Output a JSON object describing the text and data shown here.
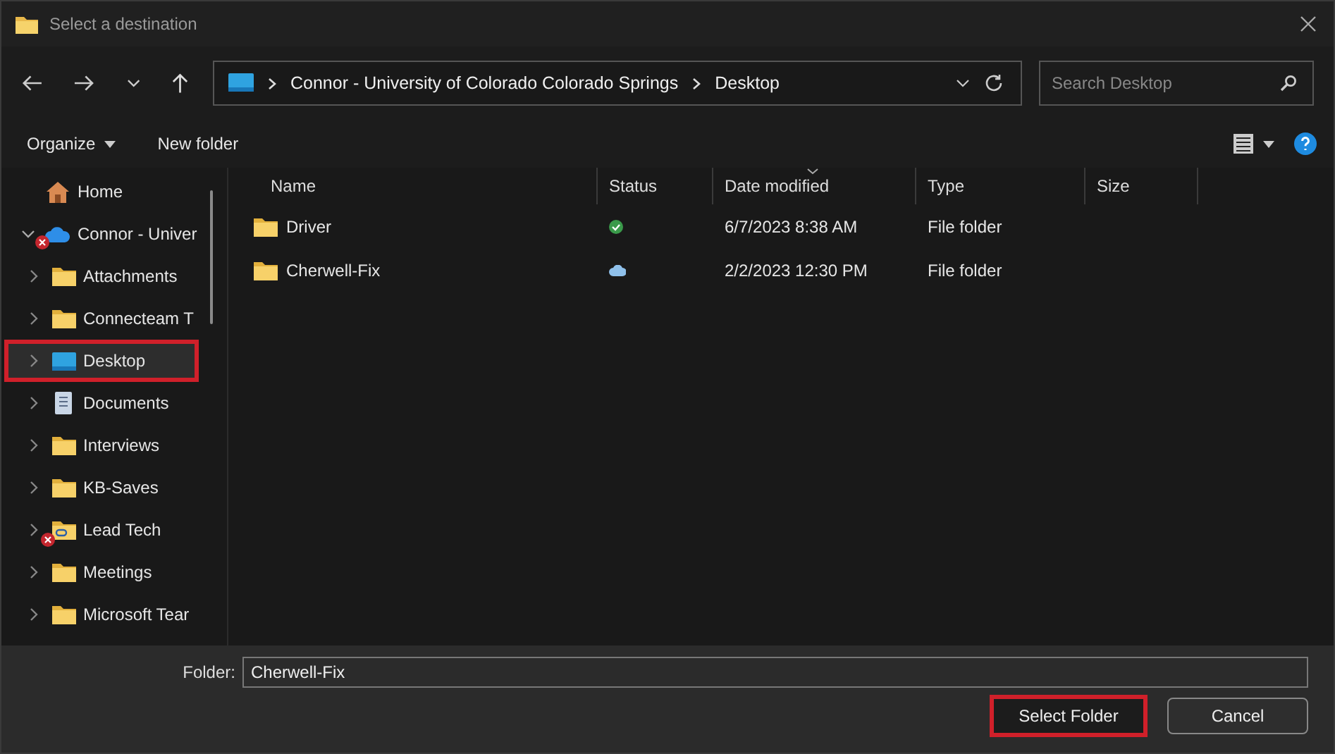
{
  "window": {
    "title": "Select a destination"
  },
  "address": {
    "segments": [
      "Connor - University of Colorado Colorado Springs",
      "Desktop"
    ]
  },
  "search": {
    "placeholder": "Search Desktop"
  },
  "commands": {
    "organize": "Organize",
    "new_folder": "New folder"
  },
  "sidebar": {
    "items": [
      {
        "label": "Home",
        "kind": "home"
      },
      {
        "label": "Connor - Univer",
        "kind": "cloud",
        "expanded": true,
        "error": true,
        "children": [
          {
            "label": "Attachments",
            "kind": "folder",
            "expanded": false,
            "error": false,
            "highlighted": false
          },
          {
            "label": "Connecteam T",
            "kind": "folder",
            "expanded": false,
            "error": false,
            "highlighted": false
          },
          {
            "label": "Desktop",
            "kind": "desktop",
            "expanded": false,
            "error": false,
            "highlighted": true
          },
          {
            "label": "Documents",
            "kind": "documents",
            "expanded": false,
            "error": false,
            "highlighted": false
          },
          {
            "label": "Interviews",
            "kind": "folder",
            "expanded": false,
            "error": false,
            "highlighted": false
          },
          {
            "label": "KB-Saves",
            "kind": "folder",
            "expanded": false,
            "error": false,
            "highlighted": false
          },
          {
            "label": "Lead Tech",
            "kind": "shared",
            "expanded": false,
            "error": true,
            "highlighted": false
          },
          {
            "label": "Meetings",
            "kind": "folder",
            "expanded": false,
            "error": false,
            "highlighted": false
          },
          {
            "label": "Microsoft Tear",
            "kind": "folder",
            "expanded": false,
            "error": false,
            "highlighted": false
          }
        ]
      }
    ]
  },
  "table": {
    "columns": [
      {
        "label": "Name",
        "sorted": false
      },
      {
        "label": "Status",
        "sorted": false
      },
      {
        "label": "Date modified",
        "sorted": true
      },
      {
        "label": "Type",
        "sorted": false
      },
      {
        "label": "Size",
        "sorted": false
      }
    ],
    "rows": [
      {
        "name": "Driver",
        "kind": "synced",
        "date": "6/7/2023 8:38 AM",
        "type": "File folder"
      },
      {
        "name": "Cherwell-Fix",
        "kind": "cloud",
        "date": "2/2/2023 12:30 PM",
        "type": "File folder"
      }
    ]
  },
  "footer": {
    "folder_label": "Folder:",
    "folder_value": "Cherwell-Fix",
    "buttons": [
      {
        "label": "Select Folder",
        "highlighted": true
      },
      {
        "label": "Cancel",
        "highlighted": false
      }
    ]
  }
}
